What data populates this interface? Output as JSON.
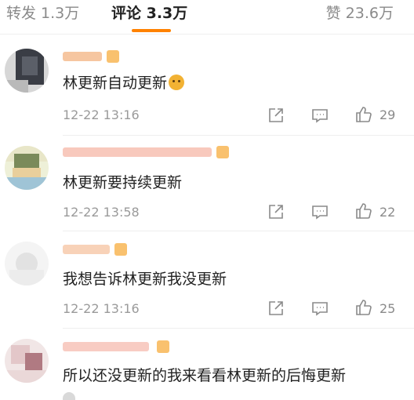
{
  "tabs": {
    "repost": "转发 1.3万",
    "comments": "评论 3.3万",
    "likes": "赞 23.6万"
  },
  "colors": {
    "accent": "#ff8200",
    "text": "#222222",
    "muted": "#9a9a9a"
  },
  "comments": [
    {
      "text": "林更新自动更新",
      "emoji": "dog-face-emoji",
      "time": "12-22 13:16",
      "likes": "29"
    },
    {
      "text": "林更新要持续更新",
      "time": "12-22 13:58",
      "likes": "22"
    },
    {
      "text": "我想告诉林更新我没更新",
      "time": "12-22 13:16",
      "likes": "25"
    },
    {
      "text": "所以还没更新的我来看看林更新的后悔更新"
    }
  ],
  "icons": {
    "share": "share-icon",
    "comment": "comment-icon",
    "like": "thumbs-up-icon"
  }
}
